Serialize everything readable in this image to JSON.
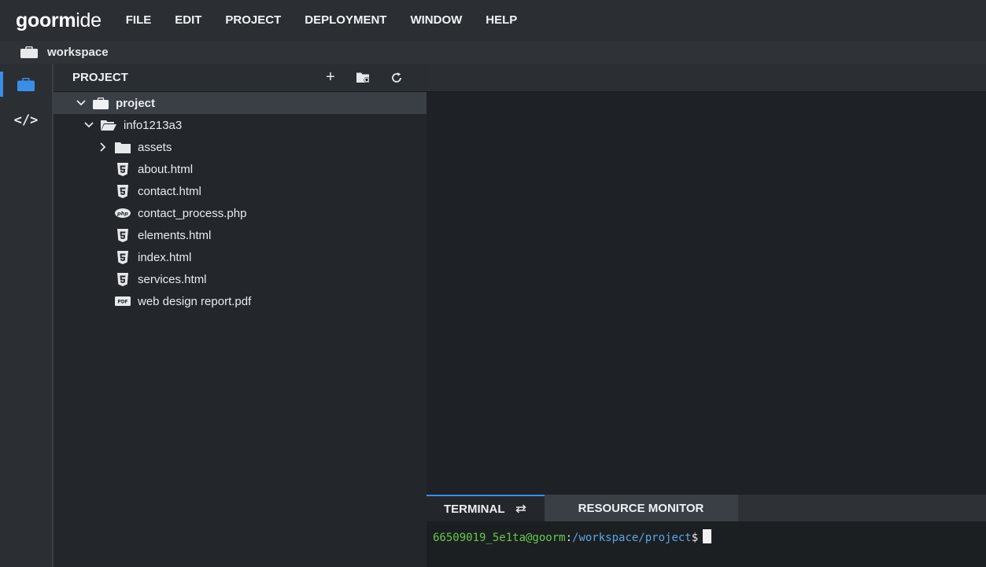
{
  "app": {
    "logo_part1": "goorm",
    "logo_part2": "ide"
  },
  "menu": [
    "FILE",
    "EDIT",
    "PROJECT",
    "DEPLOYMENT",
    "WINDOW",
    "HELP"
  ],
  "workspace": {
    "label": "workspace",
    "icon": "briefcase-icon"
  },
  "activity": [
    {
      "name": "project-explorer",
      "icon": "briefcase-icon",
      "active": true
    },
    {
      "name": "code",
      "icon": "code-icon",
      "glyph": "</>",
      "active": false
    }
  ],
  "explorer": {
    "title": "PROJECT",
    "actions": [
      {
        "name": "new-file",
        "icon": "plus-icon",
        "glyph": "+"
      },
      {
        "name": "folder-settings",
        "icon": "folder-gear-icon"
      },
      {
        "name": "refresh",
        "icon": "refresh-icon",
        "glyph": "⟳"
      }
    ],
    "tree": [
      {
        "label": "project",
        "type": "root",
        "depth": 0,
        "expanded": true,
        "selected": true
      },
      {
        "label": "info1213a3",
        "type": "folder-open",
        "depth": 1,
        "expanded": true
      },
      {
        "label": "assets",
        "type": "folder",
        "depth": 2,
        "expanded": false
      },
      {
        "label": "about.html",
        "type": "html",
        "depth": 2
      },
      {
        "label": "contact.html",
        "type": "html",
        "depth": 2
      },
      {
        "label": "contact_process.php",
        "type": "php",
        "depth": 2
      },
      {
        "label": "elements.html",
        "type": "html",
        "depth": 2
      },
      {
        "label": "index.html",
        "type": "html",
        "depth": 2
      },
      {
        "label": "services.html",
        "type": "html",
        "depth": 2
      },
      {
        "label": "web design report.pdf",
        "type": "pdf",
        "depth": 2
      }
    ]
  },
  "panel": {
    "tabs": [
      {
        "label": "TERMINAL",
        "active": true,
        "icon": "swap-icon"
      },
      {
        "label": "RESOURCE MONITOR",
        "active": false
      }
    ],
    "terminal": {
      "user": "66509019_5e1ta@goorm",
      "colon": ":",
      "path": "/workspace/project",
      "dollar": "$"
    }
  },
  "colors": {
    "accent": "#3b8ee8",
    "terminal_user": "#63c94b",
    "terminal_path": "#5aa6e6"
  }
}
